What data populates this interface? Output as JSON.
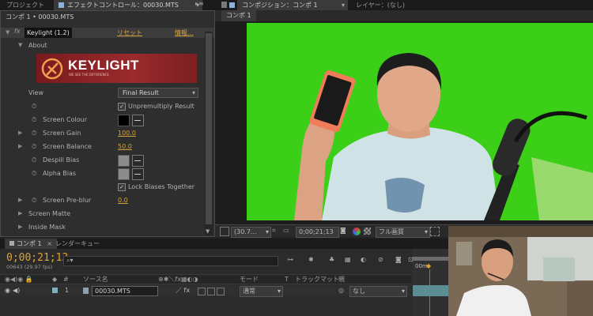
{
  "tabs": {
    "project": "プロジェクト",
    "effect_controls": "エフェクトコントロール：00030.MTS",
    "composition": "コンポジション：コンポ 1",
    "layer": "レイヤー：(なし)"
  },
  "effect_controls": {
    "breadcrumb": "コンポ 1 • 00030.MTS",
    "effect_name": "Keylight (1.2)",
    "reset": "リセット",
    "about_link": "情報...",
    "about": "About",
    "logo_text": "KEYLIGHT",
    "logo_tagline": "WE SEE THE DIFFERENCE",
    "props": {
      "view_label": "View",
      "view_value": "Final Result",
      "unpremultiply": "Unpremultiply Result",
      "screen_colour": "Screen Colour",
      "screen_gain": "Screen Gain",
      "screen_gain_value": "100.0",
      "screen_balance": "Screen Balance",
      "screen_balance_value": "50.0",
      "despill_bias": "Despill Bias",
      "alpha_bias": "Alpha Bias",
      "lock_biases": "Lock Biases Together",
      "pre_blur": "Screen Pre-blur",
      "pre_blur_value": "0.0",
      "screen_matte": "Screen Matte",
      "inside_mask": "Inside Mask"
    }
  },
  "composition": {
    "subtab": "コンポ 1",
    "zoom": "(30.7...",
    "timecode": "0;00;21;13",
    "resolution": "フル画質"
  },
  "timeline": {
    "tabs": [
      "コンポ 1",
      "レンダーキュー"
    ],
    "timecode": "0;00;21;13",
    "frame_info": "00643 (29.97 fps)",
    "search_placeholder": "",
    "columns": {
      "source_name": "ソース名",
      "mode": "モード",
      "t": "T",
      "trackmatte": "トラックマット",
      "parent": "親"
    },
    "layer": {
      "number": "1",
      "name": "00030.MTS",
      "mode": "通常",
      "parent": "なし"
    },
    "ruler_start": "00m"
  },
  "colors": {
    "accent_orange": "#d8a23a",
    "green_screen": "#3dd11a",
    "keylight_red": "#8a2025"
  }
}
